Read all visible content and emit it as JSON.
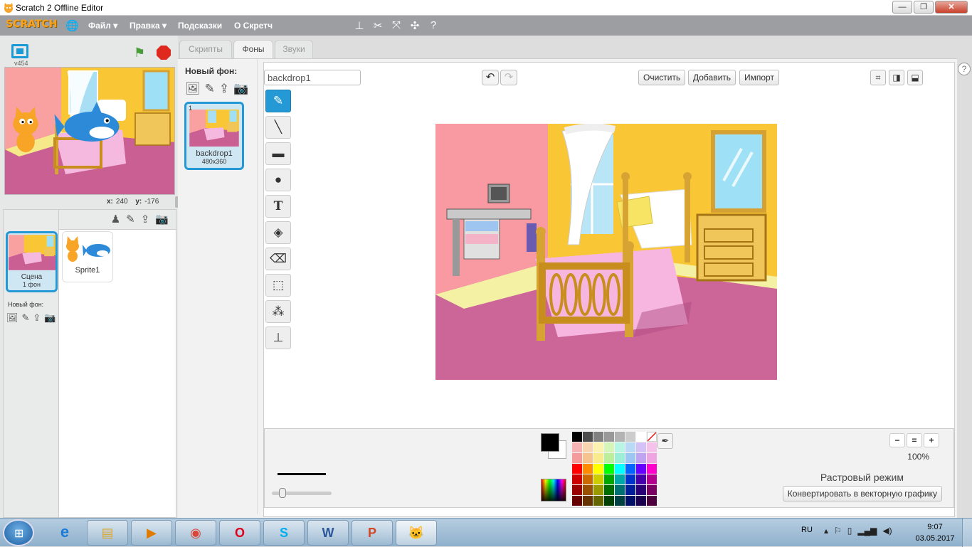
{
  "window": {
    "title": "Scratch 2 Offline Editor",
    "min": "—",
    "max": "❐",
    "close": "✕"
  },
  "menubar": {
    "logo": "SCRATCH",
    "items": [
      "Файл ▾",
      "Правка ▾",
      "Подсказки",
      "О Скретч"
    ]
  },
  "stage": {
    "version": "v454",
    "x_label": "x:",
    "x_value": "240",
    "y_label": "y:",
    "y_value": "-176"
  },
  "sprites": {
    "scene_label": "Сцена",
    "scene_sub": "1 фон",
    "new_bg_label": "Новый фон:",
    "sprite_name": "Sprite1"
  },
  "tabs": [
    "Скрипты",
    "Фоны",
    "Звуки"
  ],
  "costumes": {
    "new_bg_title": "Новый фон:",
    "items": [
      {
        "num": "1",
        "name": "backdrop1",
        "size": "480x360"
      }
    ]
  },
  "editor": {
    "name_value": "backdrop1",
    "clear": "Очистить",
    "add": "Добавить",
    "import": "Импорт",
    "zoom": "100%",
    "mode": "Растровый режим",
    "convert": "Конвертировать в векторную графику"
  },
  "palette": [
    "#000000",
    "#4d4d4d",
    "#808080",
    "#999999",
    "#b3b3b3",
    "#cccccc",
    "#ffffff",
    "none",
    "#f6b3b3",
    "#f9d4b0",
    "#fcf3b0",
    "#d5f5b9",
    "#b9f5e5",
    "#b9d9f7",
    "#d4c1f5",
    "#f5c2ec",
    "#f49b9b",
    "#f6c28e",
    "#f9ea8e",
    "#bbef9c",
    "#9cefd6",
    "#9cc7f3",
    "#bfa5f0",
    "#efa5e1",
    "#ff0000",
    "#ff8c00",
    "#ffff00",
    "#00ff00",
    "#00ffff",
    "#0066ff",
    "#6600ff",
    "#ff00cc",
    "#cc0000",
    "#cc6a00",
    "#cccc00",
    "#00a800",
    "#00a8a8",
    "#0033cc",
    "#4400aa",
    "#b3008f",
    "#990000",
    "#995000",
    "#999900",
    "#006e00",
    "#007070",
    "#001f99",
    "#2b0077",
    "#7a0061",
    "#660000",
    "#663300",
    "#666600",
    "#004000",
    "#004040",
    "#000f66",
    "#1a004d",
    "#4d003d"
  ],
  "taskbar": {
    "lang": "RU",
    "time": "9:07",
    "date": "03.05.2017"
  }
}
